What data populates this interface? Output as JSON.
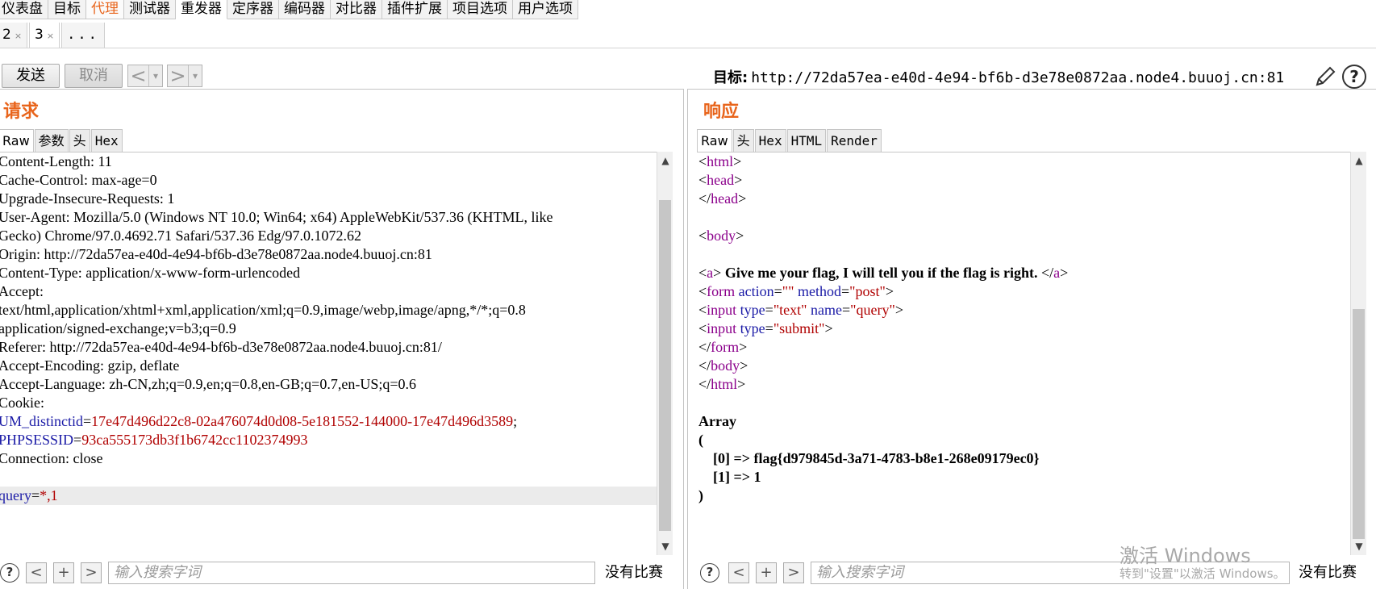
{
  "menu": {
    "tabs": [
      "仪表盘",
      "目标",
      "代理",
      "测试器",
      "重发器",
      "定序器",
      "编码器",
      "对比器",
      "插件扩展",
      "项目选项",
      "用户选项"
    ]
  },
  "subtabs": {
    "items": [
      "2",
      "3",
      "..."
    ],
    "close_glyph": "×"
  },
  "toolbar": {
    "send_label": "发送",
    "cancel_label": "取消",
    "prev_glyph": "<",
    "next_glyph": ">",
    "drop_glyph": "▾",
    "target_label": "目标:",
    "target_value": "http://72da57ea-e40d-4e94-bf6b-d3e78e0872aa.node4.buuoj.cn:81",
    "help_glyph": "?"
  },
  "request": {
    "title": "请求",
    "tabs": [
      "Raw",
      "参数",
      "头",
      "Hex"
    ],
    "headers": [
      "Content-Length: 11",
      "Cache-Control: max-age=0",
      "Upgrade-Insecure-Requests: 1",
      "User-Agent: Mozilla/5.0 (Windows NT 10.0; Win64; x64) AppleWebKit/537.36 (KHTML, like",
      "Gecko) Chrome/97.0.4692.71 Safari/537.36 Edg/97.0.1072.62",
      "Origin: http://72da57ea-e40d-4e94-bf6b-d3e78e0872aa.node4.buuoj.cn:81",
      "Content-Type: application/x-www-form-urlencoded",
      "Accept:",
      "text/html,application/xhtml+xml,application/xml;q=0.9,image/webp,image/apng,*/*;q=0.8",
      "application/signed-exchange;v=b3;q=0.9",
      "Referer: http://72da57ea-e40d-4e94-bf6b-d3e78e0872aa.node4.buuoj.cn:81/",
      "Accept-Encoding: gzip, deflate",
      "Accept-Language: zh-CN,zh;q=0.9,en;q=0.8,en-GB;q=0.7,en-US;q=0.6",
      "Cookie:"
    ],
    "cookie1_key": "UM_distinctid",
    "cookie1_value": "17e47d496d22c8-02a476074d0d08-5e181552-144000-17e47d496d3589",
    "cookie2_key": "PHPSESSID",
    "cookie2_value": "93ca555173db3f1b6742cc1102374993",
    "connection": "Connection: close",
    "body_key": "query",
    "body_value": "*,1",
    "eq": "=",
    "semicolon": ";"
  },
  "response": {
    "title": "响应",
    "tabs": [
      "Raw",
      "头",
      "Hex",
      "HTML",
      "Render"
    ],
    "html_tag": "html",
    "head_tag": "head",
    "body_tag": "body",
    "a_tag": "a",
    "a_text": " Give me your flag, I will tell you if the flag is right. ",
    "form_tag": "form",
    "input_tag": "input",
    "attr_action": "action",
    "attr_method": "method",
    "attr_type": "type",
    "attr_name": "name",
    "val_empty": "\"\"",
    "val_post": "\"post\"",
    "val_text": "\"text\"",
    "val_query": "\"query\"",
    "val_submit": "\"submit\"",
    "array_label": "Array",
    "open_paren": "(",
    "close_paren": ")",
    "item0": "    [0] => flag{d979845d-3a71-4783-b8e1-268e09179ec0}",
    "item1": "    [1] => 1"
  },
  "search": {
    "placeholder": "输入搜索字词",
    "no_match": "没有比赛",
    "help_glyph": "?",
    "prev_glyph": "<",
    "add_glyph": "+",
    "next_glyph": ">"
  },
  "watermark": {
    "line1": "激活 Windows",
    "line2": "转到\"设置\"以激活 Windows。"
  }
}
